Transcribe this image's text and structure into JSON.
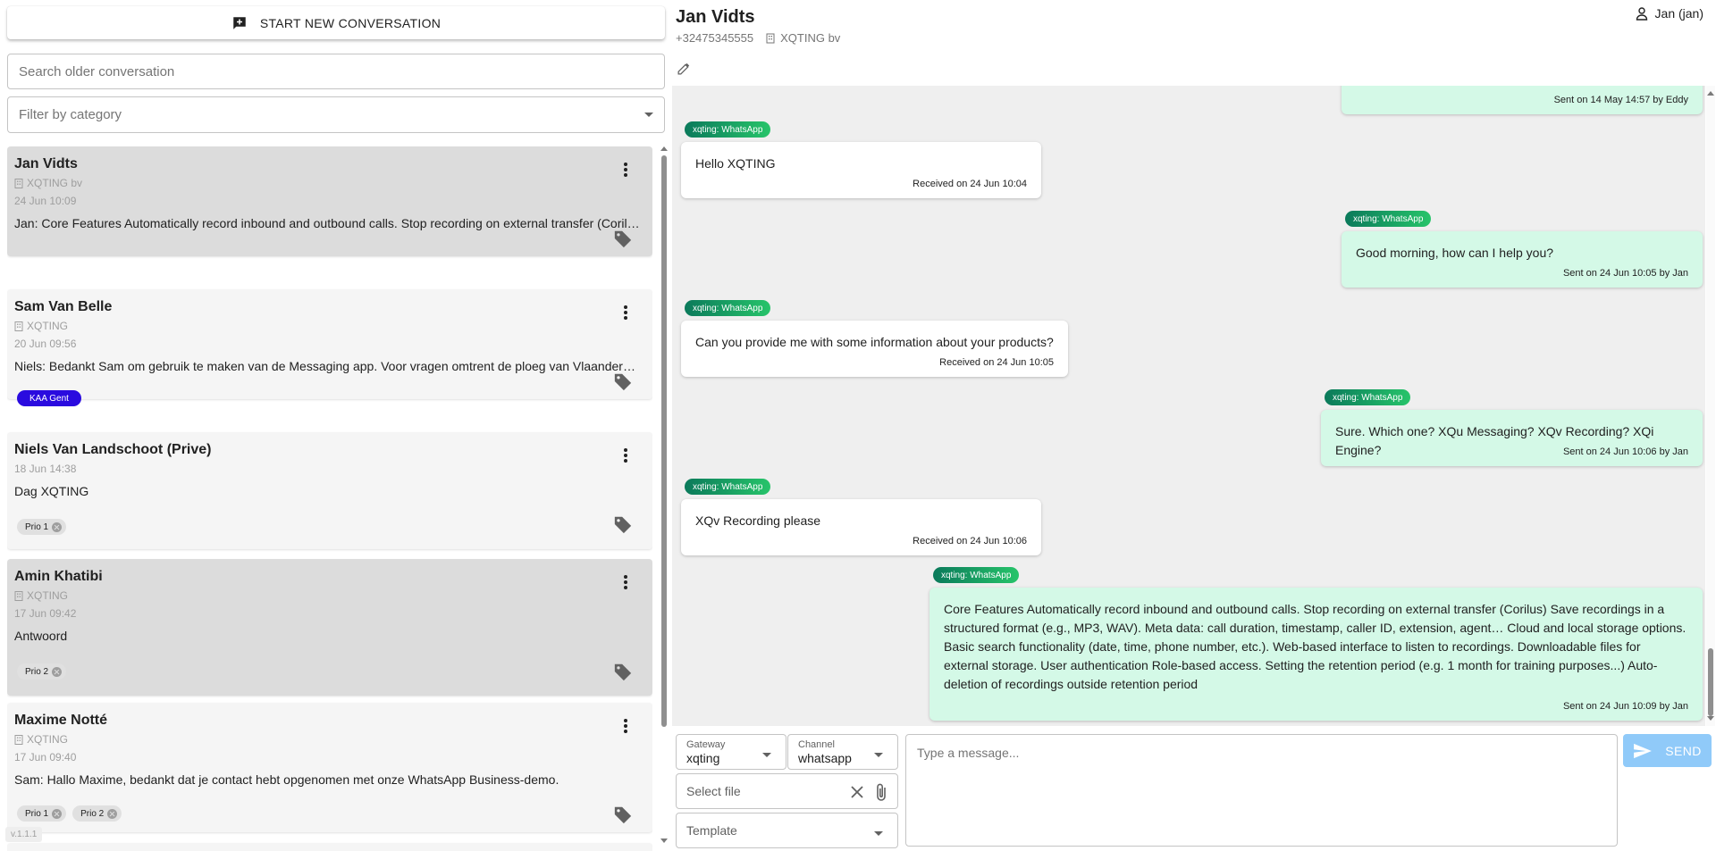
{
  "sidebar": {
    "new_conversation_label": "START NEW CONVERSATION",
    "search_placeholder": "Search older conversation",
    "filter_placeholder": "Filter by category",
    "version": "v.1.1.1",
    "conversations": [
      {
        "name": "Jan Vidts",
        "company": "XQTING bv",
        "date": "24 Jun 10:09",
        "preview": "Jan: Core Features Automatically record inbound and outbound calls. Stop recording on external transfer (Corilus) Save recordings in a structured format",
        "tags": [],
        "selected": true
      },
      {
        "name": "Sam Van Belle",
        "company": "XQTING",
        "date": "20 Jun 09:56",
        "preview": "Niels: Bedankt Sam om gebruik te maken van de Messaging app. Voor vragen omtrent de ploeg van Vlaanderen kan je altijd terecht bij ons",
        "tags": [
          "KAA Gent"
        ],
        "selected": false
      },
      {
        "name": "Niels Van Landschoot (Prive)",
        "company": "",
        "date": "18 Jun 14:38",
        "preview": "Dag XQTING",
        "tags": [
          "Prio 1"
        ],
        "selected": false
      },
      {
        "name": "Amin Khatibi",
        "company": "XQTING",
        "date": "17 Jun 09:42",
        "preview": "Antwoord",
        "tags": [
          "Prio 2"
        ],
        "selected": true
      },
      {
        "name": "Maxime Notté",
        "company": "XQTING",
        "date": "17 Jun 09:40",
        "preview": "Sam: Hallo Maxime, bedankt dat je contact hebt opgenomen met onze WhatsApp Business-demo.",
        "tags": [
          "Prio 1",
          "Prio 2"
        ],
        "selected": false
      }
    ]
  },
  "header": {
    "contact_name": "Jan Vidts",
    "phone": "+32475345555",
    "company": "XQTING bv",
    "user": "Jan (jan)"
  },
  "chat": {
    "messages": [
      {
        "direction": "out",
        "badge": "",
        "text": "",
        "meta": "Sent on 14 May 14:57 by Eddy"
      },
      {
        "direction": "in",
        "badge": "xqting: WhatsApp",
        "text": "Hello XQTING",
        "meta": "Received on 24 Jun 10:04"
      },
      {
        "direction": "out",
        "badge": "xqting: WhatsApp",
        "text": "Good morning, how can I help you?",
        "meta": "Sent on 24 Jun 10:05 by Jan"
      },
      {
        "direction": "in",
        "badge": "xqting: WhatsApp",
        "text": "Can you provide me with some information about your products?",
        "meta": "Received on 24 Jun 10:05"
      },
      {
        "direction": "out",
        "badge": "xqting: WhatsApp",
        "text": "Sure. Which one? XQu Messaging? XQv Recording? XQi Engine?",
        "meta": "Sent on 24 Jun 10:06 by Jan"
      },
      {
        "direction": "in",
        "badge": "xqting: WhatsApp",
        "text": "XQv Recording please",
        "meta": "Received on 24 Jun 10:06"
      },
      {
        "direction": "out",
        "badge": "xqting: WhatsApp",
        "text": "Core Features Automatically record inbound and outbound calls. Stop recording on external transfer (Corilus) Save recordings in a structured format (e.g., MP3, WAV). Meta data: call duration, timestamp, caller ID, extension, agent… Cloud and local storage options. Basic search functionality (date, time, phone number, etc.). Web-based interface to listen to recordings. Downloadable files for external storage. User authentication Role-based access. Setting the retention period (e.g. 1 month for training purposes...) Auto-deletion of recordings outside retention period",
        "meta": "Sent on 24 Jun 10:09 by Jan"
      }
    ]
  },
  "composer": {
    "gateway_label": "Gateway",
    "gateway_value": "xqting",
    "channel_label": "Channel",
    "channel_value": "whatsapp",
    "file_placeholder": "Select file",
    "template_placeholder": "Template",
    "message_placeholder": "Type a message...",
    "send_label": "SEND"
  },
  "colors": {
    "accent_send": "#90caf9",
    "outgoing_bubble": "#d4f9e7",
    "badge_green": "#1fa463",
    "tag_kaa": "#2a0bdf"
  }
}
